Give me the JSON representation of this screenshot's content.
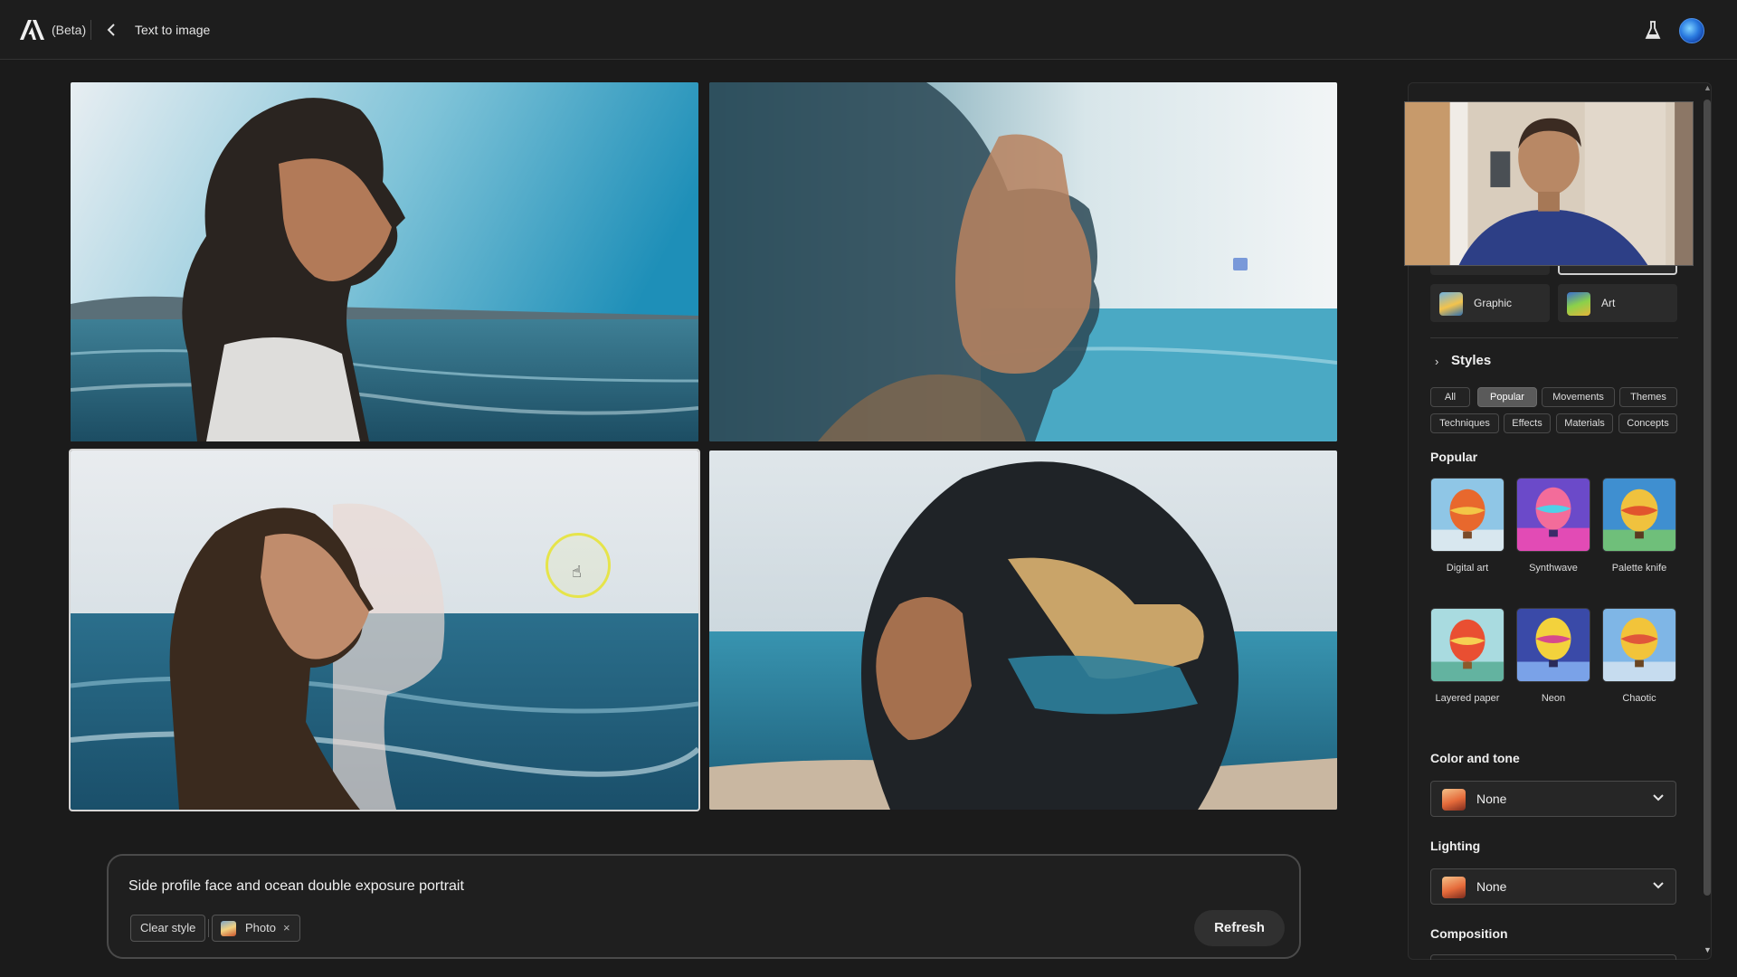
{
  "header": {
    "beta_label": "(Beta)",
    "page_title": "Text to image"
  },
  "icons": {
    "logo": "adobe-logo-icon",
    "back": "chevron-left-icon",
    "labs": "flask-icon",
    "avatar": "user-avatar"
  },
  "results": [
    {
      "id": "result-1"
    },
    {
      "id": "result-2"
    },
    {
      "id": "result-3",
      "selected": true
    },
    {
      "id": "result-4"
    }
  ],
  "prompt": {
    "text": "Side profile face and ocean double exposure portrait",
    "clear_style_label": "Clear style",
    "applied_style_chip": "Photo",
    "remove_chip_glyph": "×",
    "refresh_label": "Refresh"
  },
  "panel": {
    "content_types": [
      {
        "label": "Graphic"
      },
      {
        "label": "Art"
      }
    ],
    "styles": {
      "heading": "Styles",
      "filters": [
        {
          "label": "All",
          "active": false
        },
        {
          "label": "Popular",
          "active": true
        },
        {
          "label": "Movements",
          "active": false
        },
        {
          "label": "Themes",
          "active": false
        },
        {
          "label": "Techniques",
          "active": false
        },
        {
          "label": "Effects",
          "active": false
        },
        {
          "label": "Materials",
          "active": false
        },
        {
          "label": "Concepts",
          "active": false
        }
      ],
      "section_label": "Popular",
      "items": [
        {
          "label": "Digital art"
        },
        {
          "label": "Synthwave"
        },
        {
          "label": "Palette knife"
        },
        {
          "label": "Layered paper"
        },
        {
          "label": "Neon"
        },
        {
          "label": "Chaotic"
        }
      ]
    },
    "color_and_tone": {
      "label": "Color and tone",
      "value": "None"
    },
    "lighting": {
      "label": "Lighting",
      "value": "None"
    },
    "composition": {
      "label": "Composition"
    }
  },
  "colors": {
    "background": "#1b1b1b",
    "panel": "#1e1e1e",
    "active_filter": "#5a5a5a",
    "cursor_highlight": "#e6e44a"
  }
}
